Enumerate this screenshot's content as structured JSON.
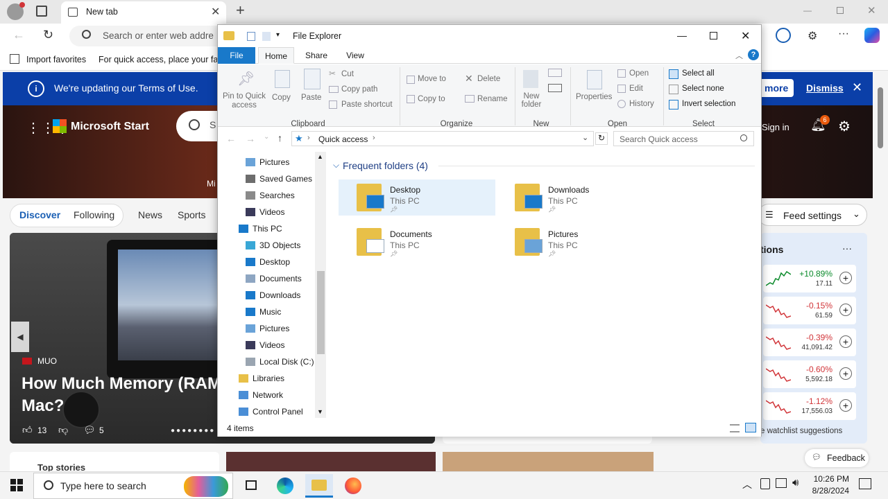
{
  "browser": {
    "tab_title": "New tab",
    "address_placeholder": "Search or enter web addre",
    "favorites_import": "Import favorites",
    "favorites_hint": "For quick access, place your favo"
  },
  "msn": {
    "banner_text": "We're updating our Terms of Use.",
    "learn_more": "more",
    "dismiss": "Dismiss",
    "brand": "Microsoft Start",
    "search_partial": "S",
    "hero_partial": "Mi",
    "sign_in": "Sign in",
    "notifications_count": "6",
    "feed_tabs": [
      "Discover",
      "Following",
      "News",
      "Sports"
    ],
    "feed_settings": "Feed settings",
    "card_source": "MUO",
    "card_headline_line1": "How Much Memory (RAM",
    "card_headline_line2": "Mac?",
    "card_likes": "13",
    "card_comments": "5",
    "watchlist_title": "tions",
    "watchlist_more": "···",
    "stocks": [
      {
        "change": "+10.89%",
        "price": "17.11",
        "dir": "up"
      },
      {
        "change": "-0.15%",
        "price": "61.59",
        "dir": "down"
      },
      {
        "change": "-0.39%",
        "price": "41,091.42",
        "dir": "down"
      },
      {
        "change": "-0.60%",
        "price": "5,592.18",
        "dir": "down"
      },
      {
        "change": "-1.12%",
        "price": "17,556.03",
        "dir": "down"
      }
    ],
    "watchlist_suggestions": "e watchlist suggestions",
    "top_stories": "Top stories",
    "feedback": "Feedback",
    "colors": {
      "banner": "#0b3fa8",
      "up": "#0a8a2a",
      "down": "#d13438"
    }
  },
  "explorer": {
    "title": "File Explorer",
    "ribbon_tabs": [
      "File",
      "Home",
      "Share",
      "View"
    ],
    "clipboard": {
      "pin": "Pin to Quick access",
      "copy": "Copy",
      "paste": "Paste",
      "cut": "Cut",
      "copy_path": "Copy path",
      "paste_shortcut": "Paste shortcut",
      "label": "Clipboard"
    },
    "organize": {
      "move_to": "Move to",
      "copy_to": "Copy to",
      "delete": "Delete",
      "rename": "Rename",
      "label": "Organize"
    },
    "new": {
      "new_folder": "New folder",
      "label": "New"
    },
    "open": {
      "properties": "Properties",
      "open": "Open",
      "edit": "Edit",
      "history": "History",
      "label": "Open"
    },
    "select": {
      "select_all": "Select all",
      "select_none": "Select none",
      "invert": "Invert selection",
      "label": "Select"
    },
    "path": "Quick access",
    "search_placeholder": "Search Quick access",
    "nav_items": [
      {
        "label": "Pictures",
        "icon": "pictures-icon",
        "level": 1
      },
      {
        "label": "Saved Games",
        "icon": "saved-games-icon",
        "level": 1
      },
      {
        "label": "Searches",
        "icon": "search-icon",
        "level": 1
      },
      {
        "label": "Videos",
        "icon": "videos-icon",
        "level": 1
      },
      {
        "label": "This PC",
        "icon": "this-pc-icon",
        "level": 0
      },
      {
        "label": "3D Objects",
        "icon": "3d-objects-icon",
        "level": 1
      },
      {
        "label": "Desktop",
        "icon": "desktop-icon",
        "level": 1
      },
      {
        "label": "Documents",
        "icon": "documents-icon",
        "level": 1
      },
      {
        "label": "Downloads",
        "icon": "downloads-icon",
        "level": 1
      },
      {
        "label": "Music",
        "icon": "music-icon",
        "level": 1
      },
      {
        "label": "Pictures",
        "icon": "pictures-icon",
        "level": 1
      },
      {
        "label": "Videos",
        "icon": "videos-icon",
        "level": 1
      },
      {
        "label": "Local Disk (C:)",
        "icon": "disk-icon",
        "level": 1
      },
      {
        "label": "Libraries",
        "icon": "libraries-icon",
        "level": 0
      },
      {
        "label": "Network",
        "icon": "network-icon",
        "level": 0
      },
      {
        "label": "Control Panel",
        "icon": "control-panel-icon",
        "level": 0
      }
    ],
    "section_title": "Frequent folders (4)",
    "folders": [
      {
        "name": "Desktop",
        "location": "This PC"
      },
      {
        "name": "Downloads",
        "location": "This PC"
      },
      {
        "name": "Documents",
        "location": "This PC"
      },
      {
        "name": "Pictures",
        "location": "This PC"
      }
    ],
    "status": "4 items"
  },
  "taskbar": {
    "search_placeholder": "Type here to search",
    "time": "10:26 PM",
    "date": "8/28/2024"
  }
}
